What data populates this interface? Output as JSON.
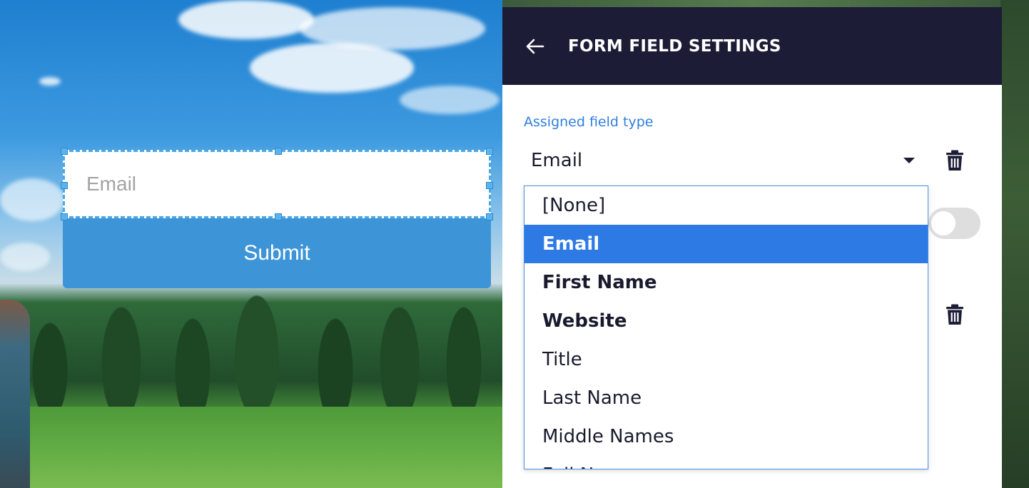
{
  "form": {
    "email_placeholder": "Email",
    "submit_label": "Submit"
  },
  "panel": {
    "title": "FORM FIELD SETTINGS",
    "back_icon": "arrow-left-icon",
    "field_label": "Assigned field type",
    "selected_value": "Email",
    "toggle_on": false
  },
  "dropdown": {
    "options": [
      {
        "label": "[None]",
        "selected": false,
        "bold": false
      },
      {
        "label": "Email",
        "selected": true,
        "bold": true
      },
      {
        "label": "First Name",
        "selected": false,
        "bold": true
      },
      {
        "label": "Website",
        "selected": false,
        "bold": true
      },
      {
        "label": "Title",
        "selected": false,
        "bold": false
      },
      {
        "label": "Last Name",
        "selected": false,
        "bold": false
      },
      {
        "label": "Middle Names",
        "selected": false,
        "bold": false
      },
      {
        "label": "Full Name",
        "selected": false,
        "bold": false
      }
    ]
  },
  "colors": {
    "header_bg": "#1c1c36",
    "accent": "#2d7ae5",
    "submit_bg": "#3d95d8",
    "label_blue": "#2f7fe0"
  }
}
